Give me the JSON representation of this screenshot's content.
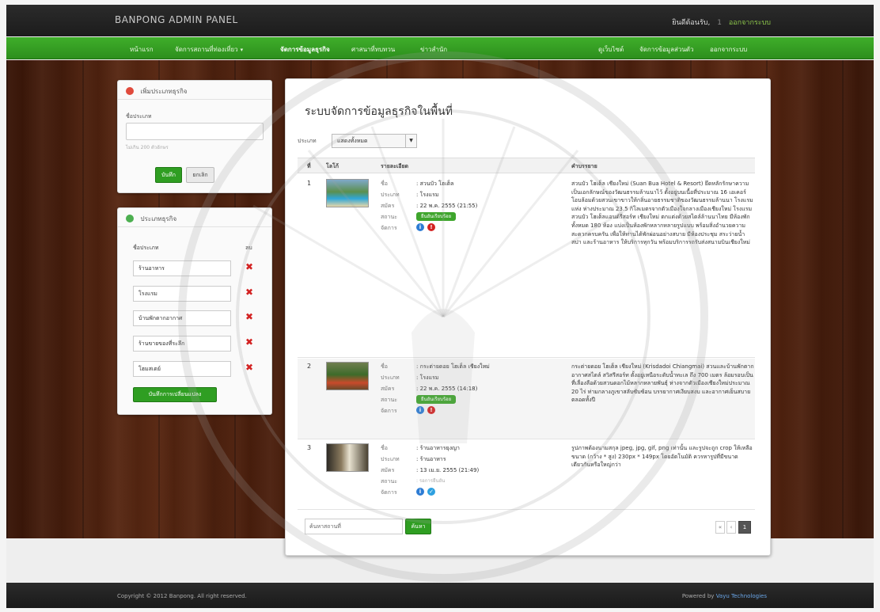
{
  "header": {
    "brand": "BANPONG ADMIN PANEL",
    "user_greeting": "ยินดีต้อนรับ,",
    "user_num": "1",
    "user_link": "ออกจากระบบ"
  },
  "nav": {
    "items": [
      {
        "label": "หน้าแรก"
      },
      {
        "label": "จัดการสถานที่ท่องเที่ยว",
        "caret": "▾"
      },
      {
        "label": "จัดการข้อมูลธุรกิจ"
      },
      {
        "label": "ศาสนาที่ทบทวน"
      },
      {
        "label": "ข่าวสำนัก"
      }
    ],
    "right_items": [
      {
        "label": "ดูเว็บไซต์"
      },
      {
        "label": "จัดการข้อมูลส่วนตัว"
      },
      {
        "label": "ออกจากระบบ"
      }
    ]
  },
  "add_box": {
    "title": "เพิ่มประเภทธุรกิจ",
    "field_label": "ชื่อประเภท",
    "hint": "ไม่เกิน 200 ตัวอักษร",
    "save": "บันทึก",
    "cancel": "ยกเลิก"
  },
  "types_box": {
    "title": "ประเภทธุรกิจ",
    "col_name": "ชื่อประเภท",
    "col_del": "ลบ",
    "items": [
      "ร้านอาหาร",
      "โรงแรม",
      "บ้านพักตากอากาศ",
      "ร้านขายของที่ระลึก",
      "โฮมสเตย์"
    ],
    "save_changes": "บันทึกการเปลี่ยนแปลง"
  },
  "main": {
    "title": "ระบบจัดการข้อมูลธุรกิจในพื้นที่",
    "filter_label": "ประเภท",
    "filter_value": "แสดงทั้งหมด",
    "columns": {
      "num": "ที่",
      "logo": "โลโก้",
      "detail": "รายละเอียด",
      "desc": "คำบรรยาย"
    },
    "detail_keys": {
      "name": "ชื่อ",
      "type": "ประเภท",
      "date": "สมัคร",
      "status": "สถานะ",
      "manage": "จัดการ"
    },
    "rows": [
      {
        "num": "1",
        "name": ": สวนบัว โฮเต็ล",
        "type": ": โรงแรม",
        "date": ": 22 พ.ค. 2555 (21:55)",
        "status": "ยืนยันเรียบร้อย",
        "desc": "สวนบัว โฮเต็ล เชียงใหม่ (Suan Bua Hotel & Resort) ยึดหลักรักษาความเป็นเอกลักษณ์ของวัฒนธรรมล้านนาไว้ ตั้งอยู่บนเนื้อที่ประมาณ 16 เอเคอร์โอบล้อมด้วยสวนเขาขาวให้กลิ่นอายธรรมชาติของวัฒนธรรมล้านนา โรงแรมแห่ง ห่างประมาณ 23.5 กิโลเมตรจากตัวเมืองใจกลางเมืองเชียงใหม่ โรงแรม สวนบัว โฮเต็ลแอนด์รีสอร์ท เชียงใหม่ ตกแต่งด้วยสไตล์ล้านนาไทย มีห้องพักทั้งหมด 180 ห้อง แบ่งเป็นห้องพักหลากหลายรูปแบบ พร้อมสิ่งอำนวยความสะดวกครบครัน เพื่อให้ท่านได้พักผ่อนอย่างสบาย มีห้องประชุม สระว่ายน้ำ สปา และร้านอาหาร ให้บริการทุกวัน พร้อมบริการรถรับส่งสนามบินเชียงใหม่"
      },
      {
        "num": "2",
        "name": ": กระต่ายดอย โฮเต็ล เชียงใหม่",
        "type": ": โรงแรม",
        "date": ": 22 พ.ค. 2555 (14:18)",
        "status": "ยืนยันเรียบร้อย",
        "desc": "กระต่ายดอย โฮเต็ล เชียงใหม่ (Krisdadoi Chiangmai) สวนและบ้านพักตากอากาศสไตล์ สวิสรีสอร์ท ตั้งอยู่เหนือระดับน้ำทะเล ถึง 700 เมตร ล้อมรอบเป็นที่เลื่องลือด้วยสวนดอกไม้หลากหลายพันธุ์ ห่างจากตัวเมืองเชียงใหม่ประมาณ 20 ไร่ ท่ามกลางภูเขาสลับซับซ้อน บรรยากาศเงียบสงบ และอากาศเย็นสบายตลอดทั้งปี"
      },
      {
        "num": "3",
        "name": ": ร้านอาหารยุงญา",
        "type": ": ร้านอาหาร",
        "date": ": 13 เม.ย. 2555 (21:49)",
        "status": ": รอการยืนยัน",
        "desc": "รูปภาพต้องนามสกุล jpeg, jpg, gif, png เท่านั้น และรูปจะถูก crop ให้เหลือขนาด (กว้าง * สูง) 230px * 149px โดยอัตโนมัติ ควรหารูปที่มีขนาดเดียวกันหรือใหญ่กว่า"
      }
    ],
    "search_placeholder": "ค้นหาสถานที่",
    "search_btn": "ค้นหา",
    "pager": [
      "«",
      "‹",
      "1"
    ]
  },
  "footer": {
    "copyright": "Copyright © 2012 Banpong. All right reserved.",
    "powered_prefix": "Powered by",
    "powered_link": "Vayu Technologies"
  },
  "colors": {
    "nav_green": "#2d8f1d",
    "header_dark": "#1c1c1c",
    "delete_red": "#d32222",
    "status_green": "#3ea52c"
  }
}
